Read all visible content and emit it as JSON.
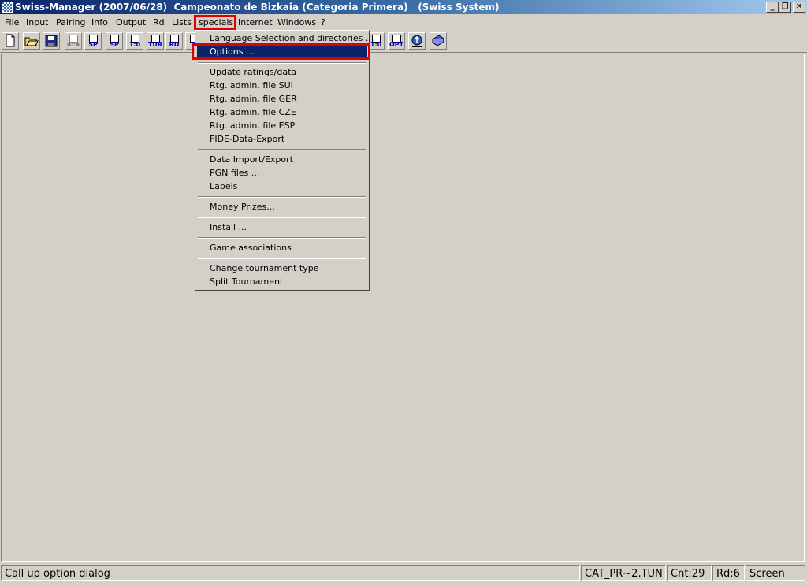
{
  "window": {
    "title": "Swiss-Manager (2007/06/28)  Campeonato de Bizkaia (Categoria Primera)   (Swiss System)",
    "minimize_glyph": "_",
    "maximize_glyph": "❐",
    "close_glyph": "✕"
  },
  "menubar": {
    "items": [
      "File",
      "Input",
      "Pairing",
      "Info",
      "Output",
      "Rd",
      "Lists",
      "specials",
      "Internet",
      "Windows",
      "?"
    ]
  },
  "toolbar": {
    "buttons": [
      {
        "icon": "new-document-icon",
        "label": ""
      },
      {
        "icon": "open-folder-icon",
        "label": ""
      },
      {
        "icon": "save-disk-icon",
        "label": ""
      },
      {
        "icon": "pairing-disabled-icon",
        "label": ""
      },
      {
        "icon": "document-icon",
        "label": "SP"
      },
      {
        "icon": "document-icon",
        "label": "SP"
      },
      {
        "icon": "document-icon",
        "label": "1:0"
      },
      {
        "icon": "document-icon",
        "label": "TUR"
      },
      {
        "icon": "document-icon",
        "label": "RD"
      },
      {
        "icon": "document-icon",
        "label": "E"
      },
      {
        "icon": "document-icon",
        "label": "1:0"
      },
      {
        "icon": "document-icon",
        "label": "OPT"
      },
      {
        "icon": "internet-upload-icon",
        "label": ""
      },
      {
        "icon": "help-book-icon",
        "label": ""
      }
    ]
  },
  "specials_menu": {
    "items": [
      "Language Selection and directories ...",
      "Options ...",
      "Update ratings/data",
      "Rtg. admin. file SUI",
      "Rtg. admin. file GER",
      "Rtg. admin. file CZE",
      "Rtg. admin. file ESP",
      "FIDE-Data-Export",
      "Data Import/Export",
      "PGN files ...",
      "Labels",
      "Money Prizes...",
      "Install ...",
      "Game associations",
      "Change tournament type",
      "Split Tournament"
    ],
    "selected": "Options ..."
  },
  "statusbar": {
    "message": "Call up option dialog",
    "file": "CAT_PR~2.TUN",
    "count": "Cnt:29",
    "round": "Rd:6",
    "mode": "Screen"
  },
  "colors": {
    "face": "#d4d0c8",
    "selection": "#0a246a",
    "annotation": "#e00000"
  }
}
